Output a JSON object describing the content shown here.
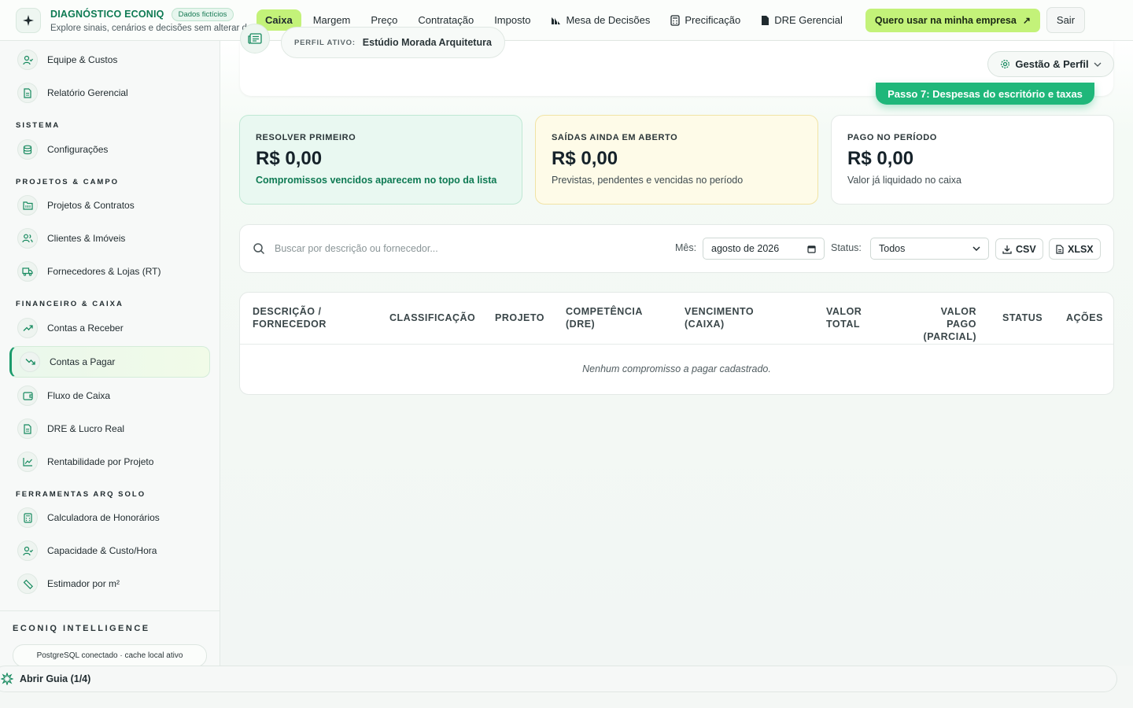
{
  "brand": {
    "title": "DIAGNÓSTICO ECONIQ",
    "badge": "Dados fictícios",
    "subtitle": "Explore sinais, cenários e decisões sem alterar da..."
  },
  "nav": {
    "items": [
      {
        "label": "Caixa",
        "active": true
      },
      {
        "label": "Margem"
      },
      {
        "label": "Preço"
      },
      {
        "label": "Contratação"
      },
      {
        "label": "Imposto"
      },
      {
        "label": "Mesa de Decisões",
        "icon": "chart-bar-icon"
      },
      {
        "label": "Precificação",
        "icon": "calculator-icon"
      },
      {
        "label": "DRE Gerencial",
        "icon": "document-icon"
      }
    ],
    "cta": "Quero usar na minha empresa",
    "cta_arrow": "↗",
    "logout": "Sair"
  },
  "sidebar": {
    "items_top": [
      {
        "label": "Equipe & Custos",
        "icon": "user-check-icon"
      },
      {
        "label": "Relatório Gerencial",
        "icon": "file-text-icon"
      }
    ],
    "section_sistema": "SISTEMA",
    "sistema": [
      {
        "label": "Configurações",
        "icon": "database-icon"
      }
    ],
    "section_projetos": "PROJETOS & CAMPO",
    "projetos": [
      {
        "label": "Projetos & Contratos",
        "icon": "folder-icon"
      },
      {
        "label": "Clientes & Imóveis",
        "icon": "users-icon"
      },
      {
        "label": "Fornecedores & Lojas (RT)",
        "icon": "truck-icon"
      }
    ],
    "section_financeiro": "FINANCEIRO & CAIXA",
    "financeiro": [
      {
        "label": "Contas a Receber",
        "icon": "trend-up-icon"
      },
      {
        "label": "Contas a Pagar",
        "icon": "trend-down-icon",
        "active": true
      },
      {
        "label": "Fluxo de Caixa",
        "icon": "wallet-icon"
      },
      {
        "label": "DRE & Lucro Real",
        "icon": "file-text-icon"
      },
      {
        "label": "Rentabilidade por Projeto",
        "icon": "line-chart-icon"
      }
    ],
    "section_ferramentas": "FERRAMENTAS ARQ SOLO",
    "ferramentas": [
      {
        "label": "Calculadora de Honorários",
        "icon": "calculator-icon"
      },
      {
        "label": "Capacidade & Custo/Hora",
        "icon": "user-check-icon"
      },
      {
        "label": "Estimador por m²",
        "icon": "ruler-icon"
      }
    ],
    "intel_title": "ECONIQ INTELLIGENCE",
    "intel_status": "PostgreSQL conectado · cache local ativo"
  },
  "header": {
    "profile_label": "PERFIL ATIVO:",
    "profile_name": "Estúdio Morada Arquitetura",
    "gestao": "Gestão & Perfil",
    "step": "Passo 7: Despesas do escritório e taxas"
  },
  "kpis": [
    {
      "label": "RESOLVER PRIMEIRO",
      "value": "R$ 0,00",
      "desc": "Compromissos vencidos aparecem no topo da lista",
      "tone": "#e8f8f0"
    },
    {
      "label": "SAÍDAS AINDA EM ABERTO",
      "value": "R$ 0,00",
      "desc": "Previstas, pendentes e vencidas no período",
      "tone": "#fefbe9"
    },
    {
      "label": "PAGO NO PERÍODO",
      "value": "R$ 0,00",
      "desc": "Valor já liquidado no caixa",
      "tone": "#ffffff"
    }
  ],
  "filters": {
    "search_placeholder": "Buscar por descrição ou fornecedor...",
    "month_label": "Mês:",
    "month_value": "agosto de 2026",
    "status_label": "Status:",
    "status_value": "Todos",
    "csv": "CSV",
    "xlsx": "XLSX"
  },
  "table": {
    "headers": [
      {
        "l1": "DESCRIÇÃO /",
        "l2": "FORNECEDOR"
      },
      {
        "l1": "CLASSIFICAÇÃO",
        "l2": ""
      },
      {
        "l1": "PROJETO",
        "l2": ""
      },
      {
        "l1": "COMPETÊNCIA",
        "l2": "(DRE)"
      },
      {
        "l1": "VENCIMENTO",
        "l2": "(CAIXA)"
      },
      {
        "l1": "VALOR",
        "l2": "TOTAL"
      },
      {
        "l1": "VALOR PAGO",
        "l2": "(PARCIAL)"
      },
      {
        "l1": "STATUS",
        "l2": ""
      },
      {
        "l1": "AÇÕES",
        "l2": ""
      }
    ],
    "empty": "Nenhum compromisso a pagar cadastrado."
  },
  "guide": {
    "label": "Abrir Guia (1/4)"
  },
  "colors": {
    "accent_lime": "#c3f279",
    "brand_green": "#0e7a53",
    "step_green": "#1fb77a"
  }
}
